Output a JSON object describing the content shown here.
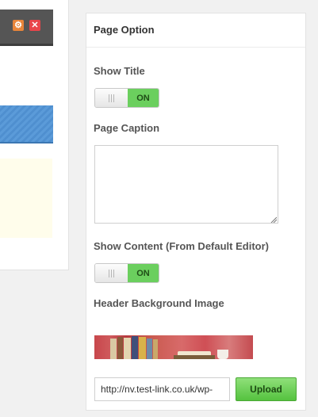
{
  "panel": {
    "title": "Page Option",
    "show_title_label": "Show Title",
    "show_title_toggle": "ON",
    "page_caption_label": "Page Caption",
    "page_caption_value": "",
    "show_content_label": "Show Content (From Default Editor)",
    "show_content_toggle": "ON",
    "header_bg_label": "Header Background Image",
    "image_url": "http://nv.test-link.co.uk/wp-",
    "upload_label": "Upload"
  },
  "left_toolbar": {
    "icons": [
      "gear-icon",
      "close-icon"
    ]
  },
  "colors": {
    "toggle_on": "#6bcf5e",
    "upload_button": "#55c23f",
    "gear_button": "#e8853a",
    "close_button": "#e8454a"
  }
}
